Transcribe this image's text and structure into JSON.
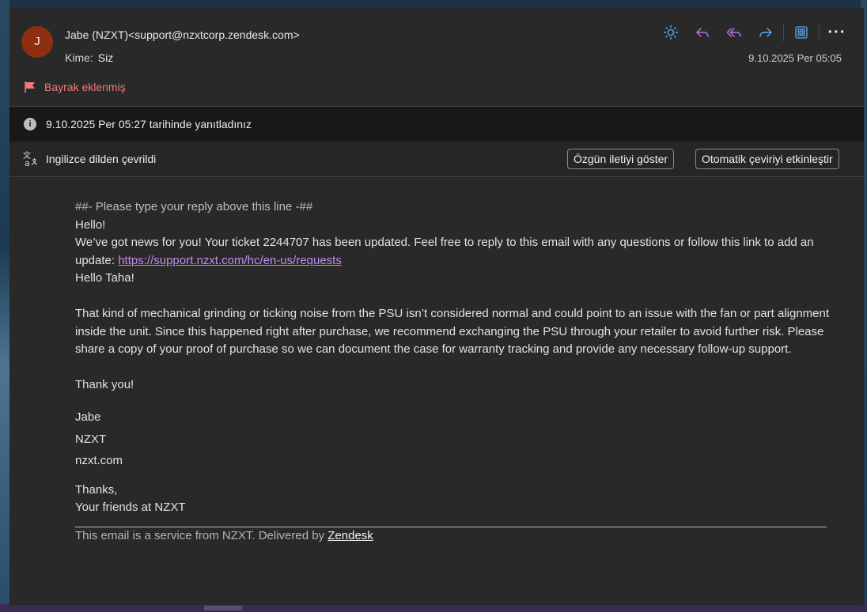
{
  "header": {
    "avatar_initial": "J",
    "sender": "Jabe (NZXT)<support@nzxtcorp.zendesk.com>",
    "to_label": "Kime:",
    "to_value": "Siz",
    "date": "9.10.2025 Per 05:05",
    "accent_color": "#5aa7f0",
    "reply_color": "#b872e0",
    "icons": [
      "sun-icon",
      "reply-icon",
      "reply-all-icon",
      "forward-icon",
      "apps-icon",
      "more-icon"
    ],
    "more_label": "···"
  },
  "flag": {
    "label": "Bayrak eklenmiş",
    "color": "#f07a79"
  },
  "info_bar": {
    "text": "9.10.2025 Per 05:27 tarihinde yanıtladınız"
  },
  "translate_bar": {
    "text": "Ingilizce dilden çevrildi",
    "show_original": "Özgün iletiyi göster",
    "enable_auto": "Otomatik çeviriyi etkinleştir"
  },
  "message": {
    "reply_line": "##- Please type your reply above this line -##",
    "hello": "Hello!",
    "news_text": "We’ve got news for you! Your ticket 2244707 has been updated. Feel free to reply to this email with any questions or follow this link to add an update: ",
    "news_link": "https://support.nzxt.com/hc/en-us/requests",
    "greeting": "Hello Taha!",
    "paragraph": "That kind of mechanical grinding or ticking noise from the PSU isn’t considered normal and could point to an issue with the fan or part alignment inside the unit. Since this happened right after purchase, we recommend exchanging the PSU through your retailer to avoid further risk. Please share a copy of your proof of purchase so we can document the case for warranty tracking and provide any necessary follow-up support.",
    "thank_you": "Thank you!",
    "sig_name": "Jabe",
    "sig_company": "NZXT",
    "sig_site": "nzxt.com",
    "closing_1": "Thanks,",
    "closing_2": "Your friends at NZXT",
    "footer_text": "This email is a service from NZXT. Delivered by ",
    "footer_link": "Zendesk"
  }
}
